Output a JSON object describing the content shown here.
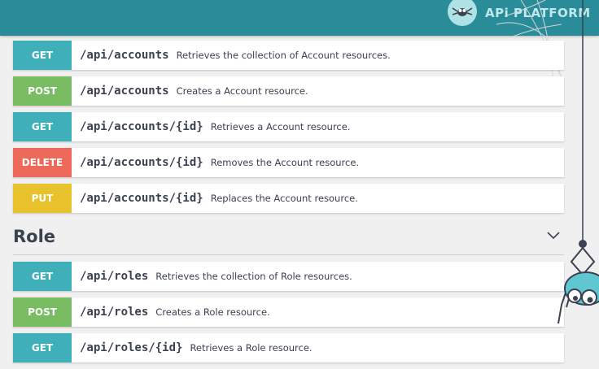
{
  "header": {
    "brand_name": "APi PLATFORM",
    "background_color": "#2a8c99"
  },
  "colors": {
    "get": "#3fafb9",
    "post": "#79bc62",
    "delete": "#ed6a5a",
    "put": "#e8c22c"
  },
  "operations_top": [
    {
      "method": "GET",
      "path": "/api/accounts",
      "description": "Retrieves the collection of Account resources."
    },
    {
      "method": "POST",
      "path": "/api/accounts",
      "description": "Creates a Account resource."
    },
    {
      "method": "GET",
      "path": "/api/accounts/{id}",
      "description": "Retrieves a Account resource."
    },
    {
      "method": "DELETE",
      "path": "/api/accounts/{id}",
      "description": "Removes the Account resource."
    },
    {
      "method": "PUT",
      "path": "/api/accounts/{id}",
      "description": "Replaces the Account resource."
    }
  ],
  "role_section": {
    "title": "Role",
    "operations": [
      {
        "method": "GET",
        "path": "/api/roles",
        "description": "Retrieves the collection of Role resources."
      },
      {
        "method": "POST",
        "path": "/api/roles",
        "description": "Creates a Role resource."
      },
      {
        "method": "GET",
        "path": "/api/roles/{id}",
        "description": "Retrieves a Role resource."
      }
    ]
  }
}
